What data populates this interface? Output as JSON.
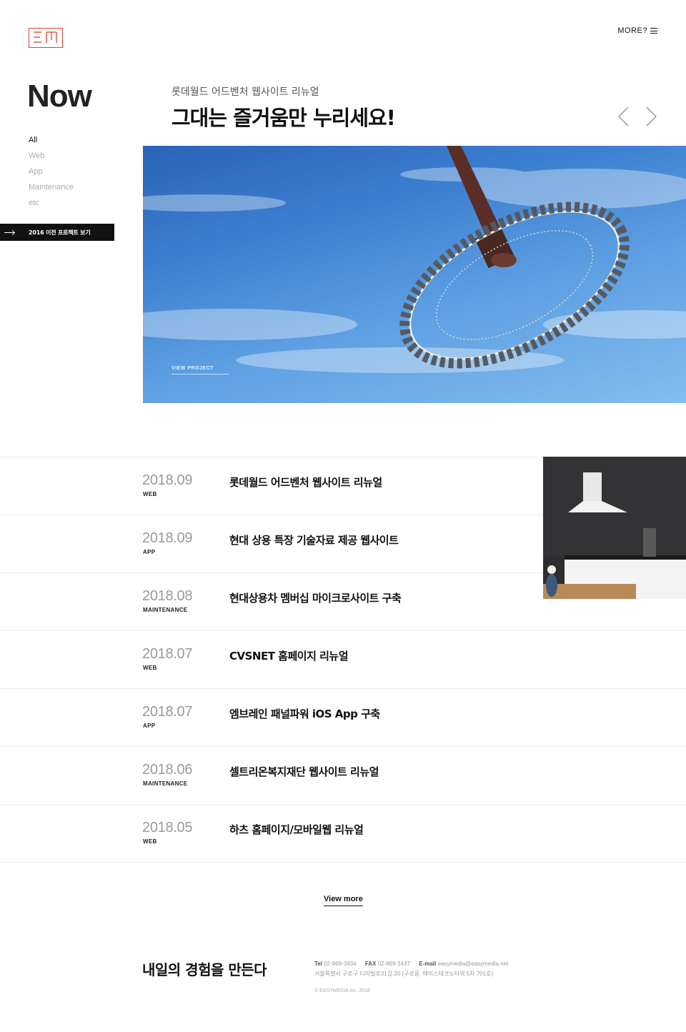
{
  "header": {
    "more_label": "MORE?"
  },
  "sidebar": {
    "title": "Now",
    "categories": [
      {
        "label": "All"
      },
      {
        "label": "Web"
      },
      {
        "label": "App"
      },
      {
        "label": "Maintenance"
      },
      {
        "label": "etc"
      }
    ],
    "prev_button": "2016 이전 프로젝트 보기"
  },
  "hero": {
    "subtitle": "롯데월드 어드벤처 웹사이트 리뉴얼",
    "title": "그대는 즐거움만 누리세요!",
    "view_project": "VIEW PROJECT"
  },
  "projects": [
    {
      "date": "2018.09",
      "category": "WEB",
      "title": "롯데월드 어드벤처 웹사이트 리뉴얼"
    },
    {
      "date": "2018.09",
      "category": "APP",
      "title": "현대 상용 특장 기술자료 제공 웹사이트"
    },
    {
      "date": "2018.08",
      "category": "MAINTENANCE",
      "title": "현대상용차 멤버십 마이크로사이트 구축"
    },
    {
      "date": "2018.07",
      "category": "WEB",
      "title": "CVSNET 홈페이지 리뉴얼"
    },
    {
      "date": "2018.07",
      "category": "APP",
      "title": "엠브레인 패널파워 iOS App 구축"
    },
    {
      "date": "2018.06",
      "category": "MAINTENANCE",
      "title": "셀트리온복지재단 웹사이트 리뉴얼"
    },
    {
      "date": "2018.05",
      "category": "WEB",
      "title": "하츠 홈페이지/모바일웹 리뉴얼"
    }
  ],
  "view_more": "View more",
  "footer": {
    "slogan": "내일의 경험을 만든다",
    "tel_label": "Tel",
    "tel": "02-869-3434",
    "fax_label": "FAX",
    "fax": "02-869-3437",
    "email_label": "E-mail",
    "email": "easymedia@easymedia.net",
    "address": "서울특별시 구로구 디지털로31길 20 (구로동, 에이스테크노타워 5차 701호)",
    "copyright": "© EASYMEDIA inc. 2018"
  }
}
